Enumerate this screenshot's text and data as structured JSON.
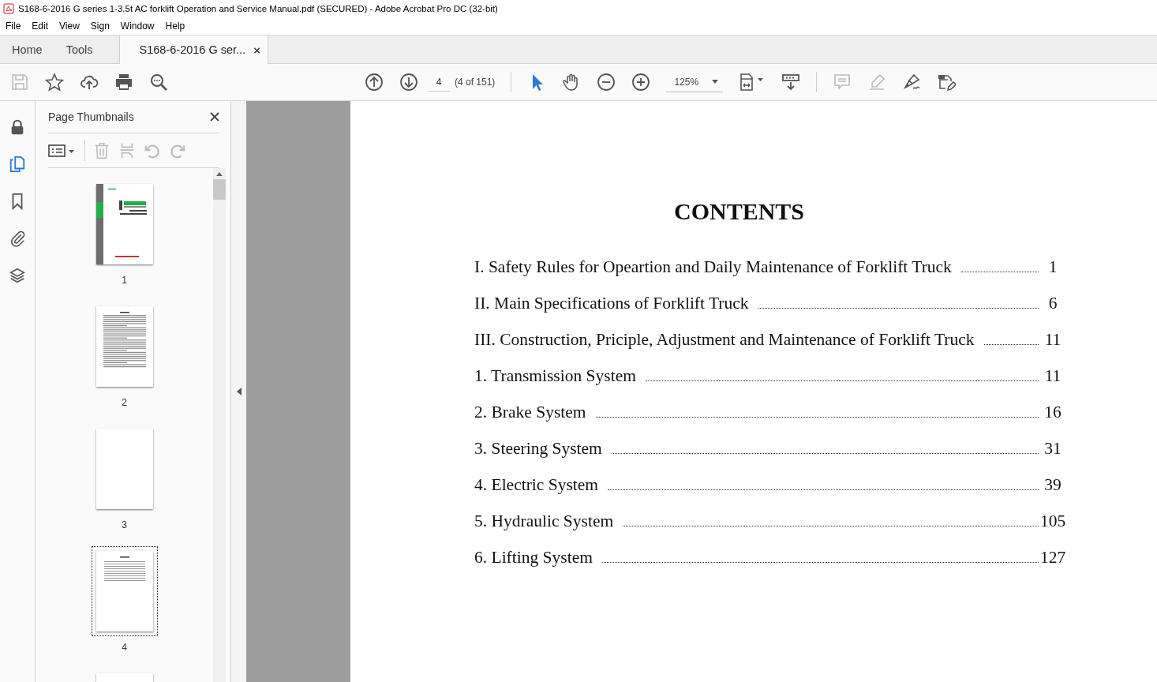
{
  "window": {
    "title": "S168-6-2016 G series 1-3.5t AC forklift Operation and Service Manual.pdf (SECURED) - Adobe Acrobat Pro DC (32-bit)"
  },
  "menu": [
    "File",
    "Edit",
    "View",
    "Sign",
    "Window",
    "Help"
  ],
  "tabs": [
    {
      "label": "Home",
      "kind": "nav",
      "selected": false
    },
    {
      "label": "Tools",
      "kind": "nav",
      "selected": false
    },
    {
      "label": "S168-6-2016 G ser...",
      "kind": "document",
      "selected": true,
      "close": "×"
    }
  ],
  "toolbar": {
    "left_tools": [
      {
        "kind": "save",
        "disabled": true
      },
      {
        "kind": "star",
        "disabled": false
      },
      {
        "kind": "upload",
        "disabled": false
      },
      {
        "kind": "print",
        "disabled": false
      },
      {
        "kind": "find",
        "disabled": false
      }
    ],
    "page_number": "4",
    "page_count": "(4 of 151)",
    "view_tools": [
      {
        "kind": "select",
        "selected": true
      },
      {
        "kind": "hand",
        "selected": false
      },
      {
        "kind": "zoom-out",
        "selected": false
      },
      {
        "kind": "zoom-in",
        "selected": false
      }
    ],
    "zoom": "125%",
    "edit_tools": [
      {
        "kind": "comment",
        "disabled": true
      },
      {
        "kind": "highlight",
        "disabled": true
      },
      {
        "kind": "sign",
        "disabled": false
      },
      {
        "kind": "edit",
        "disabled": false
      }
    ]
  },
  "rail": [
    {
      "kind": "lock",
      "selected": false
    },
    {
      "kind": "pages",
      "selected": true
    },
    {
      "kind": "bookmark",
      "selected": false
    },
    {
      "kind": "attachment",
      "selected": false
    },
    {
      "kind": "layers",
      "selected": false
    }
  ],
  "thumbnails_panel": {
    "title": "Page Thumbnails",
    "thumbnails": [
      {
        "kind": "cover",
        "label": "1",
        "selected": false
      },
      {
        "kind": "text",
        "label": "2",
        "selected": false
      },
      {
        "kind": "blank",
        "label": "3",
        "selected": false
      },
      {
        "kind": "contents",
        "label": "4",
        "selected": true
      },
      {
        "kind": "blank",
        "selected": false
      }
    ]
  },
  "document": {
    "heading": "CONTENTS",
    "entries": [
      {
        "title": "I. Safety Rules for Opeartion and Daily Maintenance of Forklift Truck",
        "page": "1"
      },
      {
        "title": "II. Main Specifications of Forklift Truck",
        "page": "6"
      },
      {
        "title": "III. Construction, Priciple, Adjustment and Maintenance of Forklift Truck",
        "page": "11"
      },
      {
        "title": "1. Transmission System",
        "page": "11"
      },
      {
        "title": "2. Brake System",
        "page": "16"
      },
      {
        "title": "3. Steering System",
        "page": "31"
      },
      {
        "title": "4. Electric System",
        "page": "39"
      },
      {
        "title": "5. Hydraulic System",
        "page": "105"
      },
      {
        "title": "6. Lifting System",
        "page": "127"
      }
    ]
  }
}
